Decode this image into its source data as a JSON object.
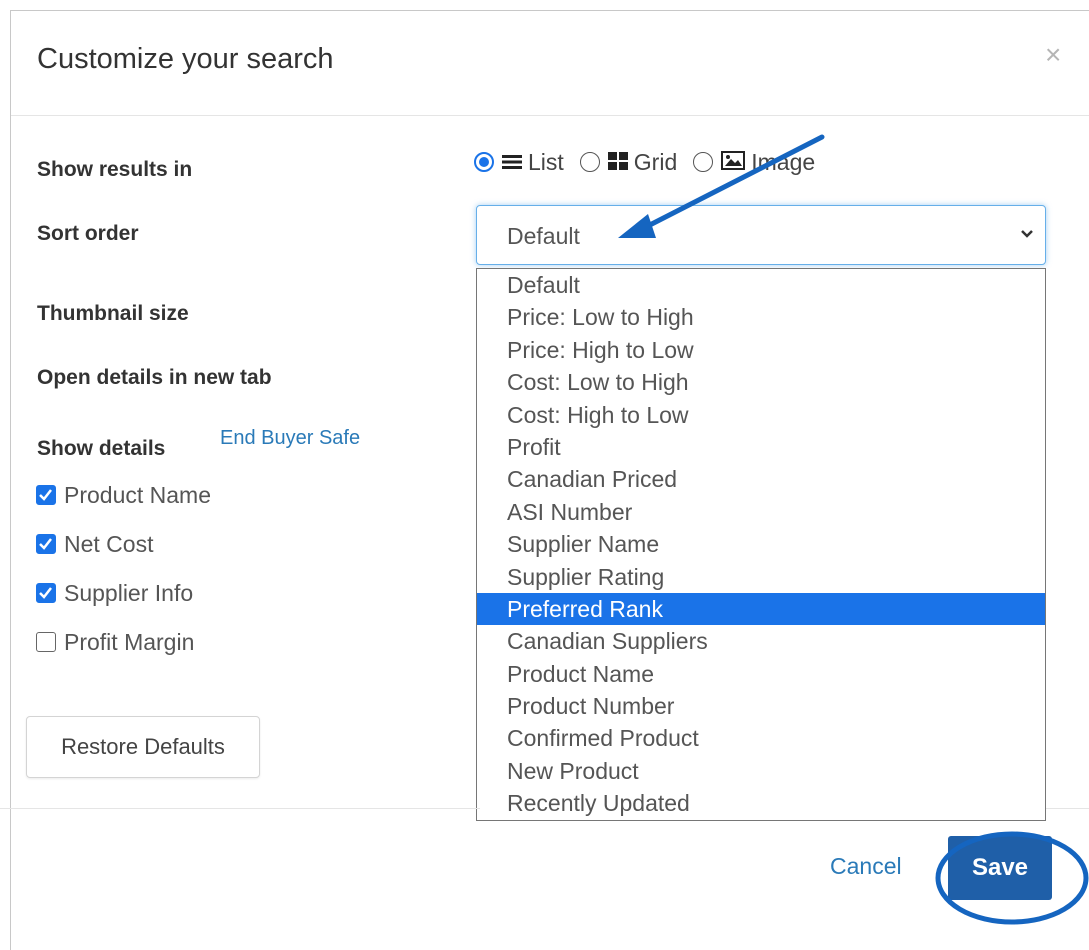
{
  "dialog": {
    "title": "Customize your search",
    "close_glyph": "×"
  },
  "labels": {
    "show_results_in": "Show results in",
    "sort_order": "Sort order",
    "thumbnail_size": "Thumbnail size",
    "open_details": "Open details in new tab",
    "show_details": "Show details"
  },
  "show_results": {
    "options": [
      {
        "label": "List",
        "icon": "list-icon",
        "checked": true
      },
      {
        "label": "Grid",
        "icon": "grid-icon",
        "checked": false
      },
      {
        "label": "Image",
        "icon": "image-icon",
        "checked": false
      }
    ]
  },
  "sort": {
    "selected": "Default",
    "options": [
      "Default",
      "Price: Low to High",
      "Price: High to Low",
      "Cost: Low to High",
      "Cost: High to Low",
      "Profit",
      "Canadian Priced",
      "ASI Number",
      "Supplier Name",
      "Supplier Rating",
      "Preferred Rank",
      "Canadian Suppliers",
      "Product Name",
      "Product Number",
      "Confirmed Product",
      "New Product",
      "Recently Updated"
    ],
    "highlighted": "Preferred Rank"
  },
  "details": {
    "link": "End Buyer Safe",
    "checkboxes": [
      {
        "label": "Product Name",
        "checked": true
      },
      {
        "label": "Net Cost",
        "checked": true
      },
      {
        "label": "Supplier Info",
        "checked": true
      },
      {
        "label": "Profit Margin",
        "checked": false
      }
    ]
  },
  "footer": {
    "restore_label": "Restore Defaults",
    "cancel_label": "Cancel",
    "save_label": "Save"
  },
  "colors": {
    "accent": "#1a73e8",
    "primary_button": "#1f5fa8",
    "annotation": "#1565c0"
  }
}
